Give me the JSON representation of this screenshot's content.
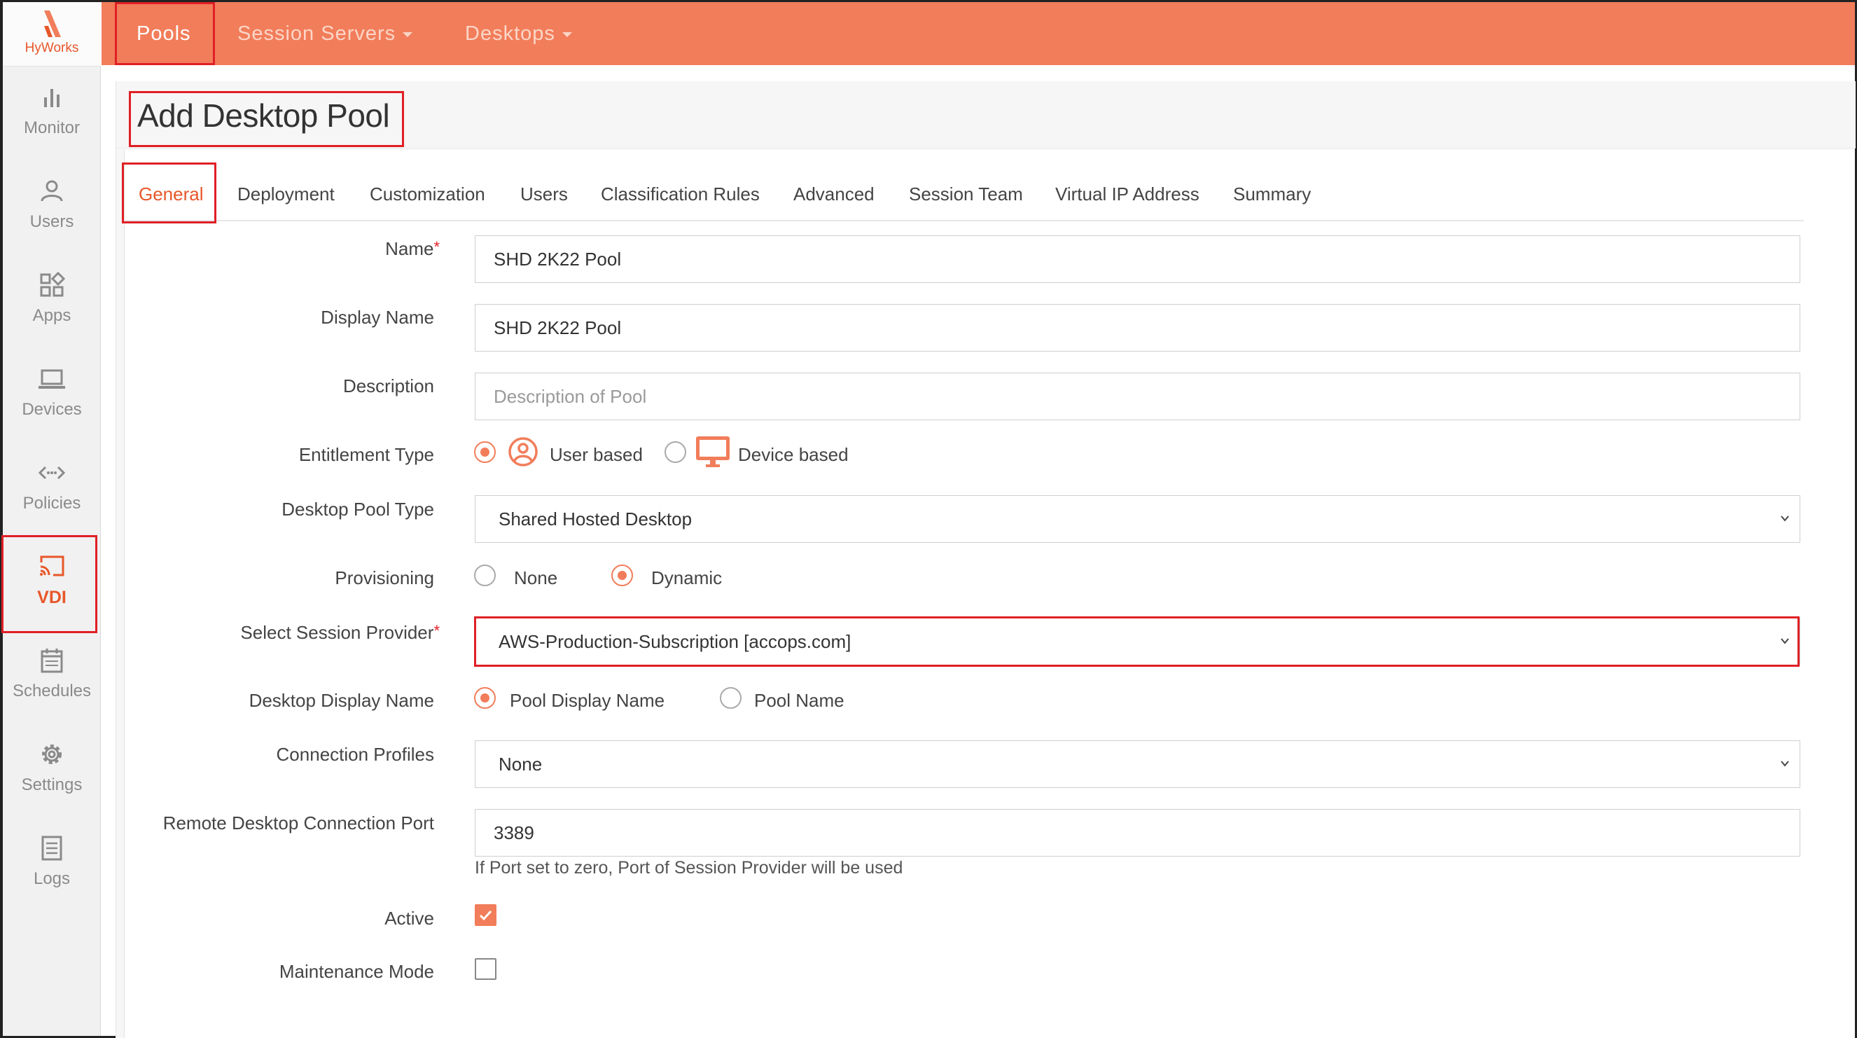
{
  "brand": {
    "name": "HyWorks",
    "color": "#e8572a"
  },
  "sidebar": {
    "items": [
      {
        "label": "Monitor",
        "icon": "bar-chart-icon"
      },
      {
        "label": "Users",
        "icon": "user-icon"
      },
      {
        "label": "Apps",
        "icon": "apps-grid-icon"
      },
      {
        "label": "Devices",
        "icon": "laptop-icon"
      },
      {
        "label": "Policies",
        "icon": "code-arrows-icon"
      },
      {
        "label": "VDI",
        "icon": "cast-icon",
        "active": true
      },
      {
        "label": "Schedules",
        "icon": "calendar-icon"
      },
      {
        "label": "Settings",
        "icon": "gear-icon"
      },
      {
        "label": "Logs",
        "icon": "document-icon"
      }
    ]
  },
  "topnav": {
    "pools": "Pools",
    "session_servers": "Session Servers",
    "desktops": "Desktops"
  },
  "page": {
    "title": "Add Desktop Pool"
  },
  "tabs": [
    "General",
    "Deployment",
    "Customization",
    "Users",
    "Classification Rules",
    "Advanced",
    "Session Team",
    "Virtual IP Address",
    "Summary"
  ],
  "form": {
    "name": {
      "label": "Name",
      "required": "*",
      "value": "SHD 2K22 Pool"
    },
    "display_name": {
      "label": "Display Name",
      "value": "SHD 2K22 Pool"
    },
    "description": {
      "label": "Description",
      "placeholder": "Description of Pool"
    },
    "entitlement_type": {
      "label": "Entitlement Type",
      "options": [
        "User based",
        "Device based"
      ],
      "selected": "User based"
    },
    "desktop_pool_type": {
      "label": "Desktop Pool Type",
      "value": "Shared Hosted Desktop"
    },
    "provisioning": {
      "label": "Provisioning",
      "options": [
        "None",
        "Dynamic"
      ],
      "selected": "Dynamic"
    },
    "session_provider": {
      "label": "Select Session Provider",
      "required": "*",
      "value": "AWS-Production-Subscription [accops.com]"
    },
    "desktop_display_name": {
      "label": "Desktop Display Name",
      "options": [
        "Pool Display Name",
        "Pool Name"
      ],
      "selected": "Pool Display Name"
    },
    "connection_profiles": {
      "label": "Connection Profiles",
      "value": "None"
    },
    "rdp_port": {
      "label": "Remote Desktop Connection Port",
      "value": "3389",
      "hint": "If Port set to zero, Port of Session Provider will be used"
    },
    "active": {
      "label": "Active",
      "checked": true
    },
    "maintenance_mode": {
      "label": "Maintenance Mode",
      "checked": false
    }
  },
  "colors": {
    "accent": "#f27d5a",
    "highlight_box": "#e01f26",
    "active_text": "#e8572a"
  }
}
